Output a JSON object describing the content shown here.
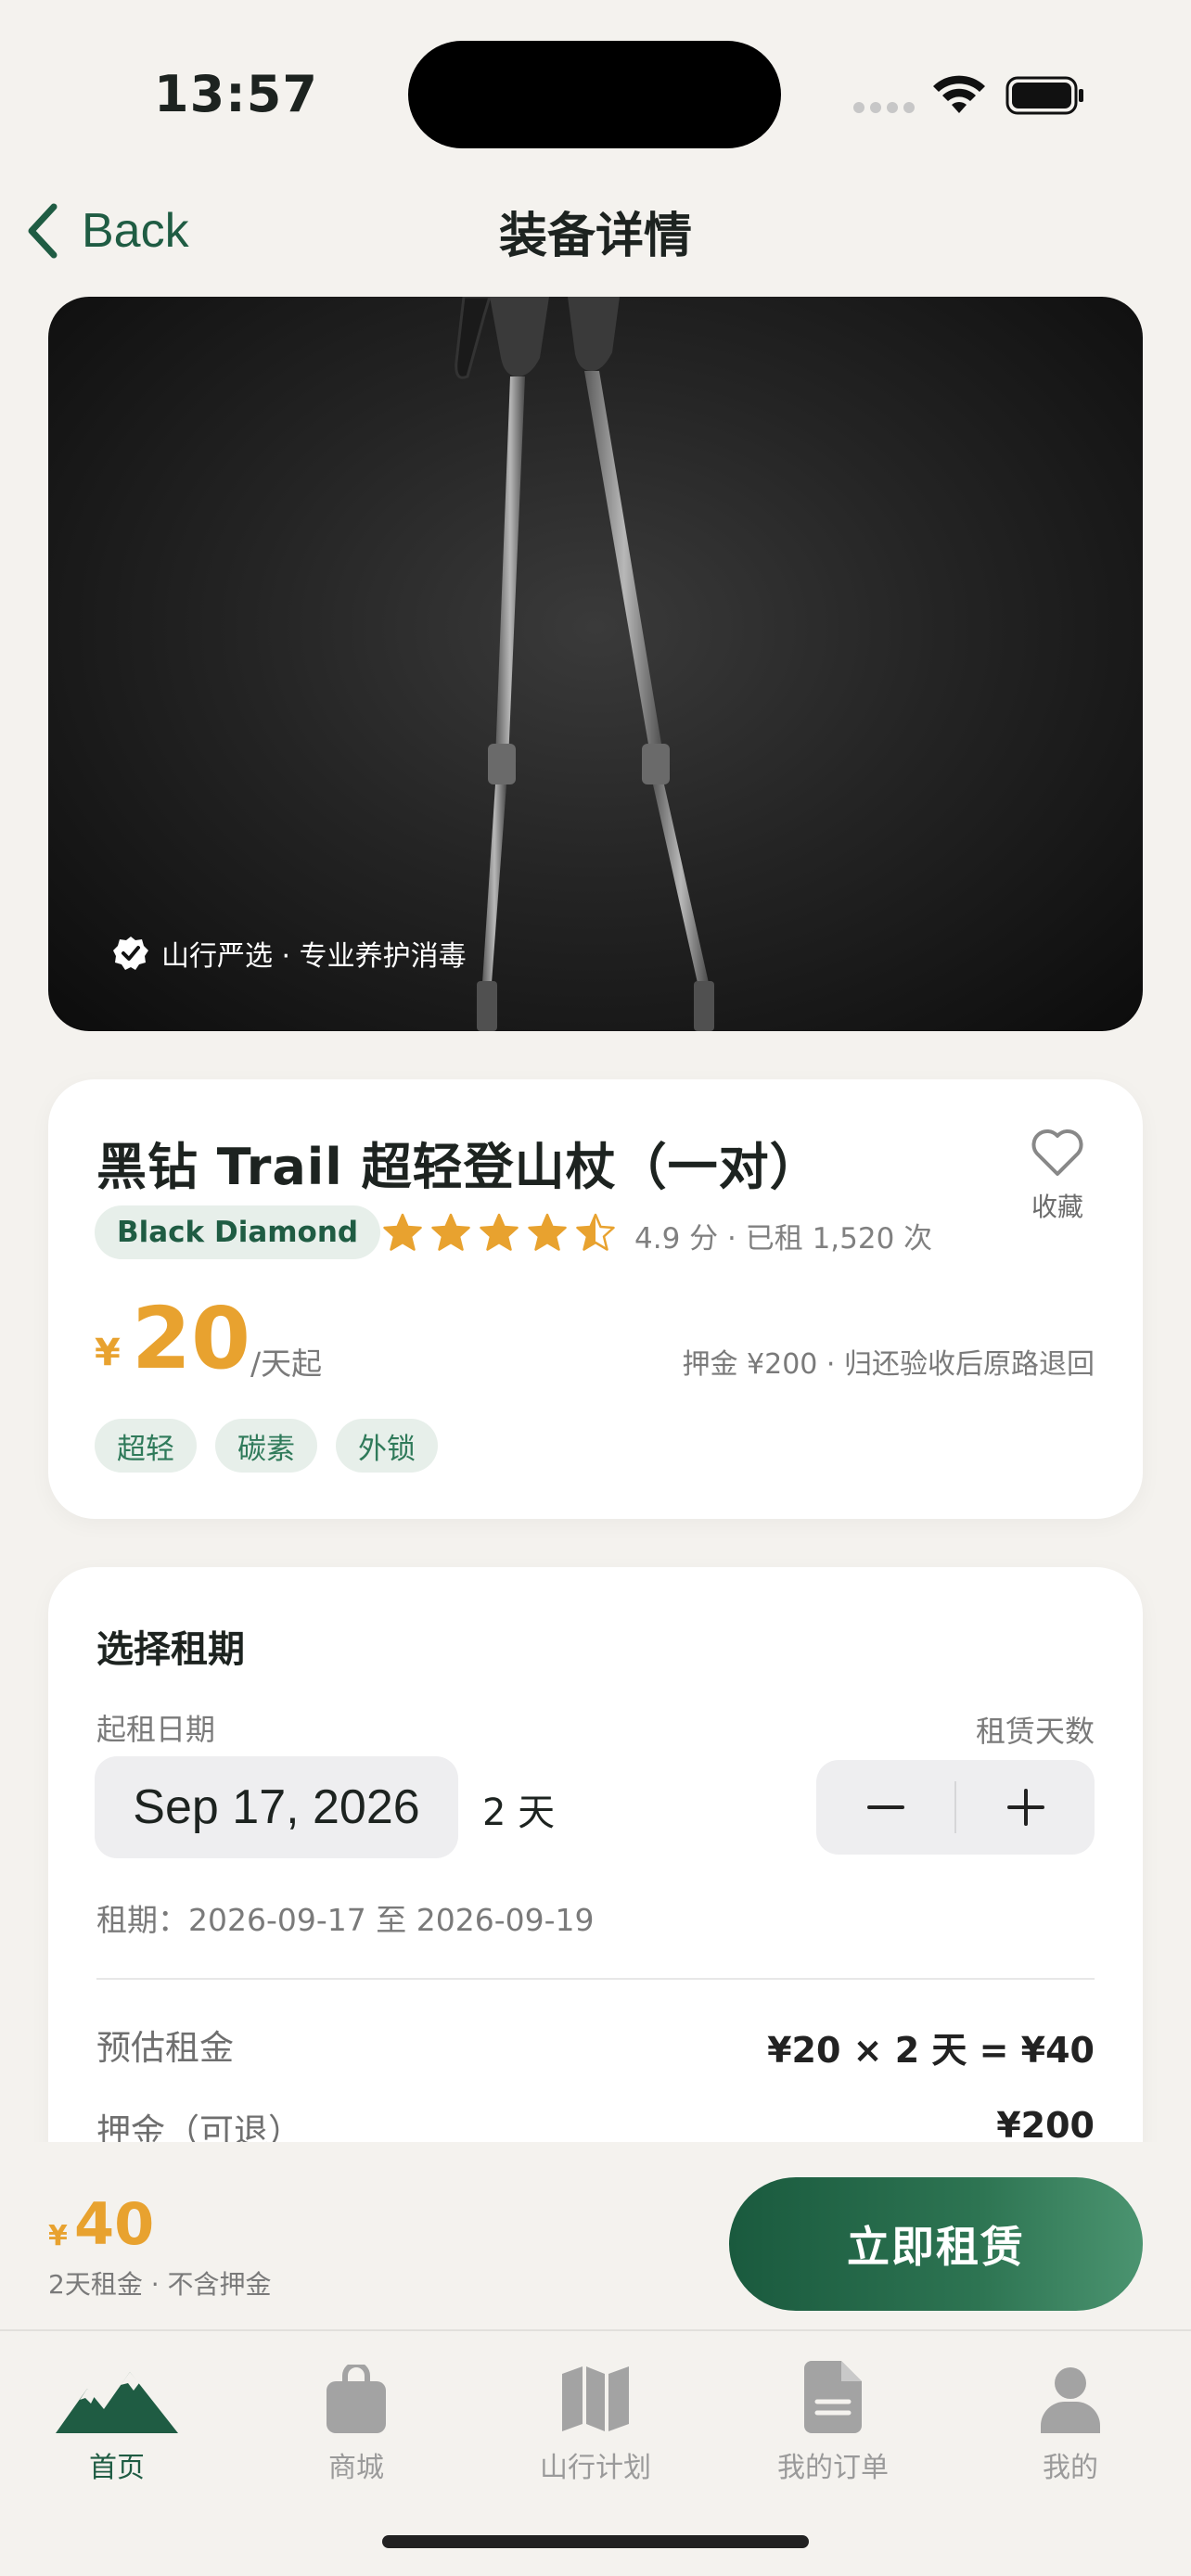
{
  "status_bar": {
    "time": "13:57"
  },
  "nav": {
    "back_label": "Back",
    "title": "装备详情"
  },
  "hero": {
    "badge_text": "山行严选 · 专业养护消毒"
  },
  "product": {
    "title": "黑钻 Trail 超轻登山杖（一对）",
    "favorite_label": "收藏",
    "brand": "Black Diamond",
    "rating_stars": 4.5,
    "rating_text": "4.9 分 · 已租 1,520 次",
    "price_currency": "¥",
    "price_value": "20",
    "price_unit": "/天起",
    "deposit_note": "押金 ¥200 · 归还验收后原路退回",
    "tags": [
      "超轻",
      "碳素",
      "外锁"
    ]
  },
  "rental": {
    "section_title": "选择租期",
    "start_date_label": "起租日期",
    "days_label": "租赁天数",
    "start_date_value": "Sep 17, 2026",
    "days_value": "2 天",
    "period_text": "租期：2026-09-17 至 2026-09-19",
    "rows": [
      {
        "label": "预估租金",
        "value": "¥20 × 2 天 = ¥40"
      },
      {
        "label": "押金（可退）",
        "value": "¥200"
      }
    ]
  },
  "action_bar": {
    "total_currency": "¥",
    "total_value": "40",
    "total_note": "2天租金 · 不含押金",
    "rent_button": "立即租赁"
  },
  "tabbar": {
    "items": [
      {
        "label": "首页",
        "icon": "mountain-icon",
        "active": true
      },
      {
        "label": "商城",
        "icon": "shopping-bag-icon",
        "active": false
      },
      {
        "label": "山行计划",
        "icon": "map-icon",
        "active": false
      },
      {
        "label": "我的订单",
        "icon": "document-icon",
        "active": false
      },
      {
        "label": "我的",
        "icon": "person-icon",
        "active": false
      }
    ]
  },
  "colors": {
    "brand_green": "#1f5c43",
    "price_orange": "#e8a22f",
    "star_gold": "#e8a22f",
    "background": "#f4f2ee"
  }
}
